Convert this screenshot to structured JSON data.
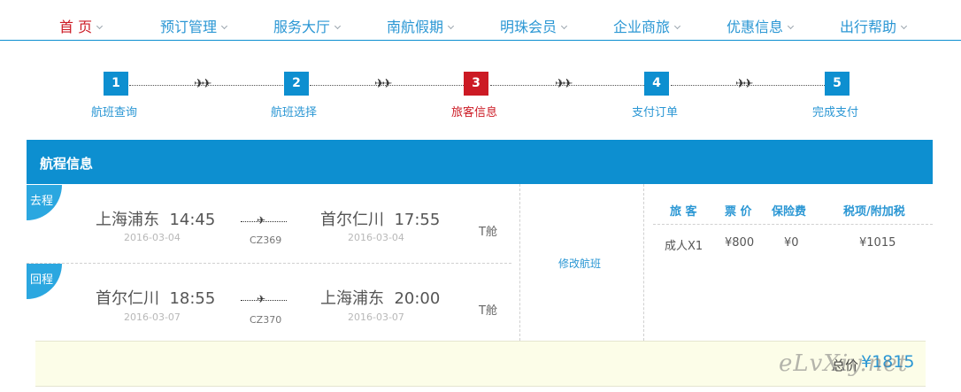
{
  "nav": {
    "items": [
      {
        "label": "首 页",
        "active": true
      },
      {
        "label": "预订管理",
        "active": false
      },
      {
        "label": "服务大厅",
        "active": false
      },
      {
        "label": "南航假期",
        "active": false
      },
      {
        "label": "明珠会员",
        "active": false
      },
      {
        "label": "企业商旅",
        "active": false
      },
      {
        "label": "优惠信息",
        "active": false
      },
      {
        "label": "出行帮助",
        "active": false
      }
    ]
  },
  "steps": {
    "current": 3,
    "items": [
      {
        "number": "1",
        "label": "航班查询"
      },
      {
        "number": "2",
        "label": "航班选择"
      },
      {
        "number": "3",
        "label": "旅客信息"
      },
      {
        "number": "4",
        "label": "支付订单"
      },
      {
        "number": "5",
        "label": "完成支付"
      }
    ],
    "plane_glyph": "✈✈"
  },
  "itinerary": {
    "title": "航程信息",
    "outbound": {
      "tag": "去程",
      "from_city": "上海浦东",
      "from_time": "14:45",
      "from_date": "2016-03-04",
      "flight": "CZ369",
      "to_city": "首尔仁川",
      "to_time": "17:55",
      "to_date": "2016-03-04",
      "cabin": "T舱"
    },
    "return": {
      "tag": "回程",
      "from_city": "首尔仁川",
      "from_time": "18:55",
      "from_date": "2016-03-07",
      "flight": "CZ370",
      "to_city": "上海浦东",
      "to_time": "20:00",
      "to_date": "2016-03-07",
      "cabin": "T舱"
    },
    "modify_label": "修改航班"
  },
  "fare": {
    "headers": [
      "旅 客",
      "票 价",
      "保险费",
      "税项/附加税"
    ],
    "row": [
      "成人X1",
      "¥800",
      "¥0",
      "¥1015"
    ]
  },
  "total": {
    "label": "总价",
    "price": "¥1815"
  },
  "watermark": "eLvXiy.net",
  "colors": {
    "brand_blue": "#0d8fd0",
    "link_blue": "#2b97d4",
    "active_red": "#cc1a24",
    "total_bg": "#fcfde8"
  }
}
